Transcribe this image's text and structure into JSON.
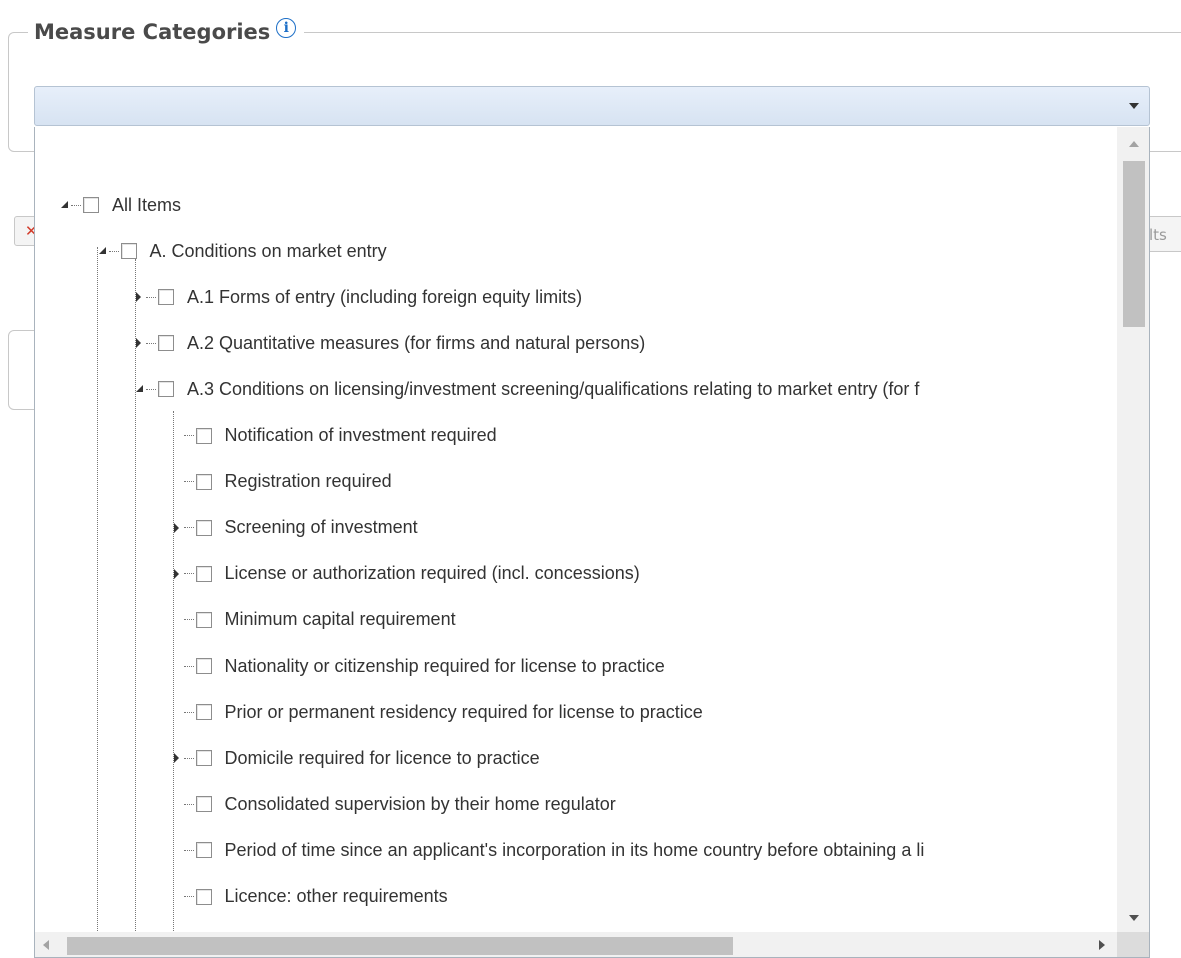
{
  "section": {
    "title": "Measure Categories"
  },
  "behind": {
    "right_button_fragment": "lts"
  },
  "dropdown": {
    "selected_value": ""
  },
  "tree": {
    "nodes": [
      {
        "level": 0,
        "expander": "open",
        "label": "All Items"
      },
      {
        "level": 1,
        "expander": "open",
        "label": "A. Conditions on market entry"
      },
      {
        "level": 2,
        "expander": "closed",
        "label": "A.1 Forms of entry (including foreign equity limits)"
      },
      {
        "level": 2,
        "expander": "closed",
        "label": "A.2 Quantitative measures (for firms and natural persons)"
      },
      {
        "level": 2,
        "expander": "open",
        "label": "A.3 Conditions on licensing/investment screening/qualifications relating to market entry (for f"
      },
      {
        "level": 3,
        "expander": "none",
        "label": "Notification of investment required"
      },
      {
        "level": 3,
        "expander": "none",
        "label": "Registration required"
      },
      {
        "level": 3,
        "expander": "closed",
        "label": "Screening of investment"
      },
      {
        "level": 3,
        "expander": "closed",
        "label": "License or authorization required (incl. concessions)"
      },
      {
        "level": 3,
        "expander": "none",
        "label": "Minimum capital requirement"
      },
      {
        "level": 3,
        "expander": "none",
        "label": "Nationality or citizenship required for license to practice"
      },
      {
        "level": 3,
        "expander": "none",
        "label": "Prior or permanent residency required for license to practice"
      },
      {
        "level": 3,
        "expander": "closed",
        "label": "Domicile required for licence to practice"
      },
      {
        "level": 3,
        "expander": "none",
        "label": "Consolidated supervision by their home regulator"
      },
      {
        "level": 3,
        "expander": "none",
        "label": "Period of time since an applicant's incorporation in its home country before obtaining a li"
      },
      {
        "level": 3,
        "expander": "none",
        "label": "Licence: other requirements"
      }
    ]
  },
  "icons": {
    "info": "info-icon",
    "dropdown": "chevron-down-icon"
  },
  "colors": {
    "accent": "#1d6fc7",
    "dropdown_bg": "#dfe9f6",
    "close_red": "#d23b2a"
  }
}
